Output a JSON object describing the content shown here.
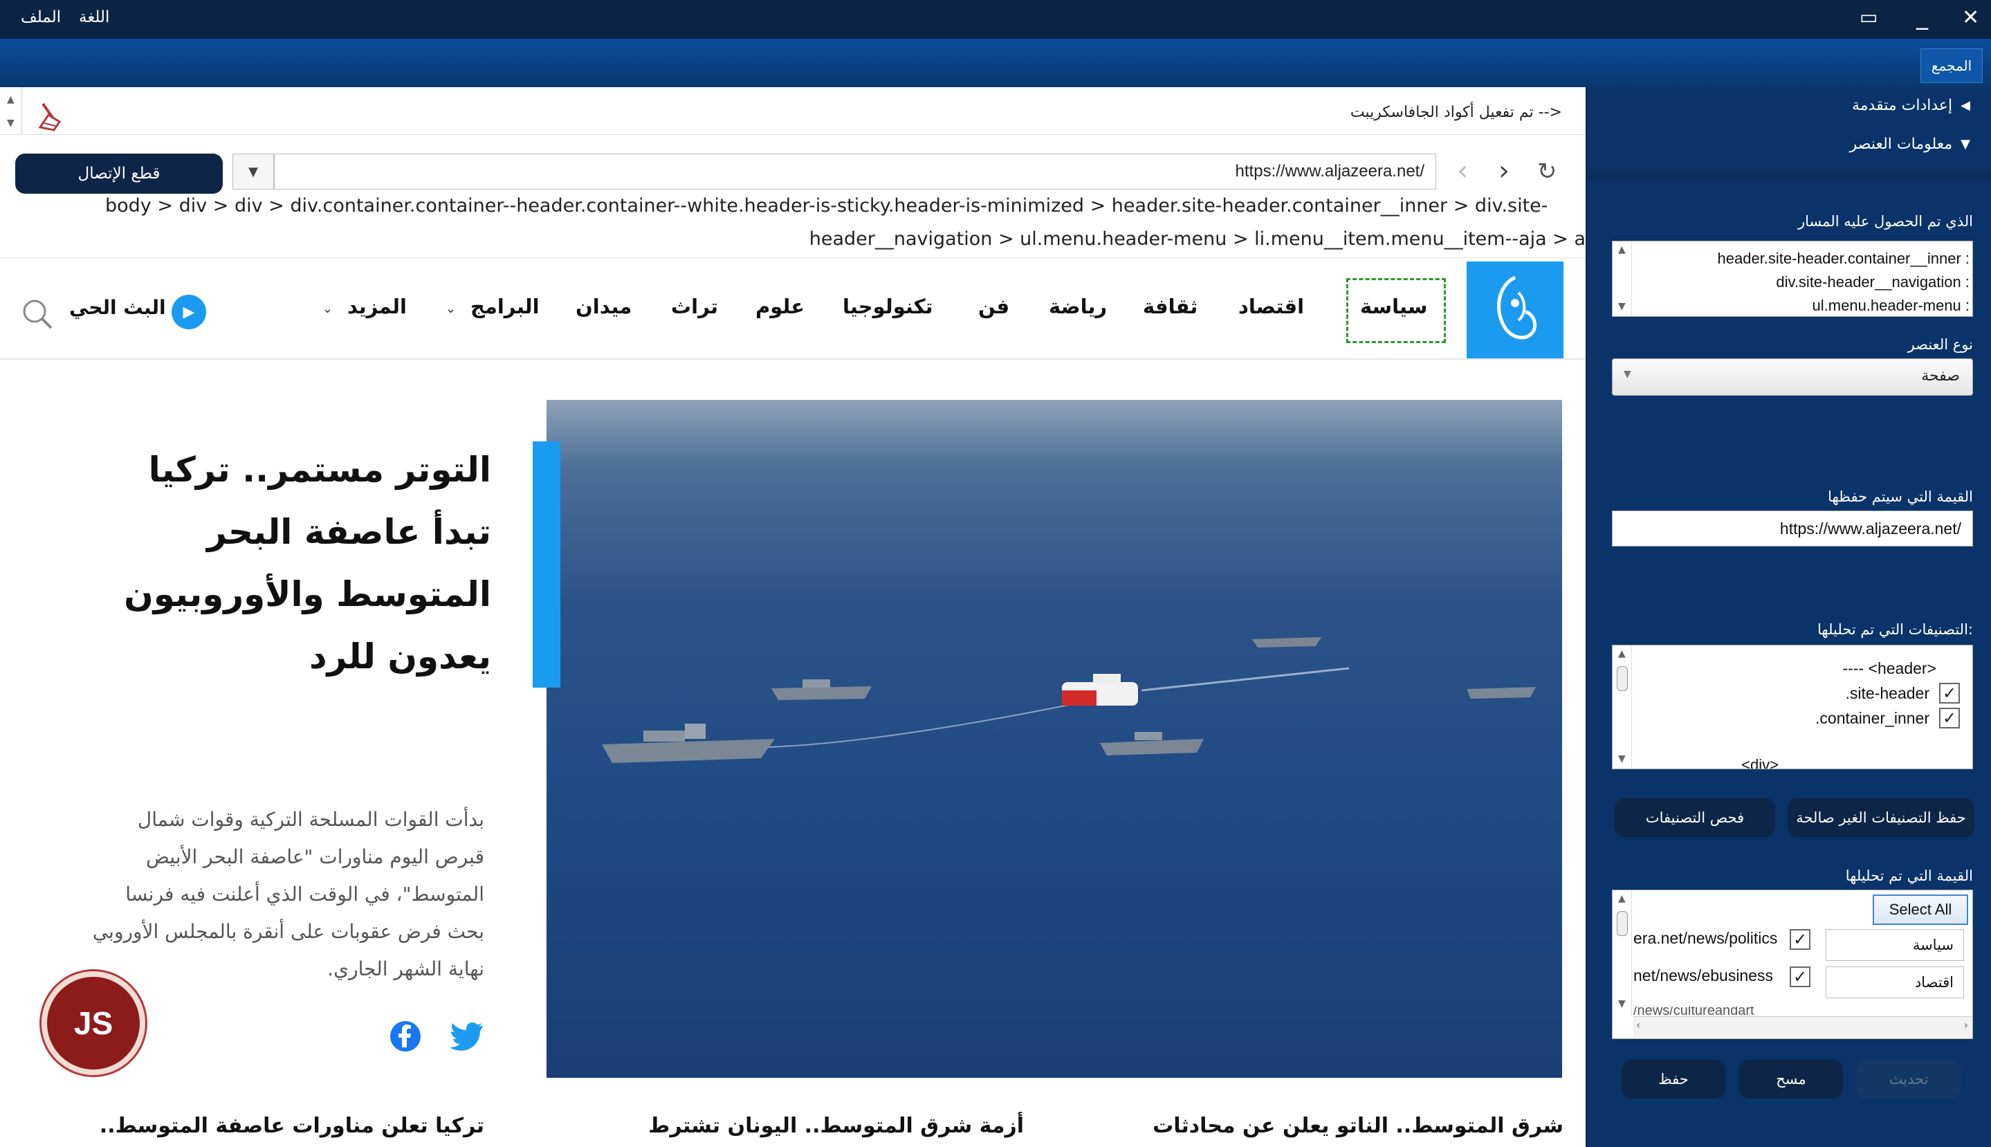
{
  "menu": {
    "file": "الملف",
    "language": "اللغة"
  },
  "tab": {
    "label": "المجمع"
  },
  "browser": {
    "js_status": "<-- تم تفعيل أكواد الجافاسكريبت",
    "disconnect_label": "قطع الإتصال",
    "url": "https://www.aljazeera.net/",
    "breadcrumb_line1": "body > div > div > div.container.container--header.container--white.header-is-sticky.header-is-minimized > header.site-header.container__inner > div.site-",
    "breadcrumb_line2": "header__navigation > ul.menu.header-menu > li.menu__item.menu__item--aja > a"
  },
  "site": {
    "nav": [
      "سياسة",
      "اقتصاد",
      "ثقافة",
      "رياضة",
      "فن",
      "تكنولوجيا",
      "علوم",
      "تراث",
      "ميدان",
      "البرامج",
      "المزيد"
    ],
    "live": "البث الحي",
    "headline": "التوتر مستمر.. تركيا تبدأ عاصفة البحر المتوسط والأوروبيون يعدون للرد",
    "summary": "بدأت القوات المسلحة التركية وقوات شمال قبرص اليوم مناورات \"عاصفة البحر الأبيض المتوسط\"، في الوقت الذي أعلنت فيه فرنسا بحث فرض عقوبات على أنقرة بالمجلس الأوروبي نهاية الشهر الجاري.",
    "bottom": [
      "شرق المتوسط.. الناتو يعلن عن محادثات",
      "أزمة شرق المتوسط.. اليونان تشترط",
      "تركيا تعلن مناورات عاصفة المتوسط.."
    ],
    "js_badge": "JS"
  },
  "panel": {
    "advanced": "إعدادات متقدمة",
    "element_info": "معلومات العنصر",
    "path_label": "الذي تم الحصول عليه المسار",
    "path_items": [
      "header.site-header.container__inner :",
      "div.site-header__navigation :",
      "ul.menu.header-menu :"
    ],
    "type_label": "نوع العنصر",
    "type_value": "صفحة",
    "value_label": "القيمة التي سيتم حفظها",
    "value": "https://www.aljazeera.net/",
    "classes_label": ":التصنيفات التي تم تحليلها",
    "classes": [
      {
        "text": "---- <header>",
        "checked": false
      },
      {
        "text": ".site-header",
        "checked": true
      },
      {
        "text": ".container_inner",
        "checked": true
      }
    ],
    "classes_overflow": "<div>",
    "save_invalid": "حفظ التصنيفات الغير صالحة",
    "check_classes": "فحص التصنيفات",
    "values_label": "القيمة التي تم تحليلها",
    "select_all": "Select All",
    "value_rows": [
      {
        "url": "era.net/news/politics",
        "name": "سياسة"
      },
      {
        "url": "net/news/ebusiness",
        "name": "اقتصاد"
      }
    ],
    "value_overflow": "/news/cultureandart",
    "save": "حفظ",
    "clear": "مسح",
    "update": "تحديث"
  },
  "colors": {
    "titlebar": "#0c2444",
    "panel": "#0a3369",
    "accent": "#1b9bef",
    "button_dark": "#0d2647"
  }
}
